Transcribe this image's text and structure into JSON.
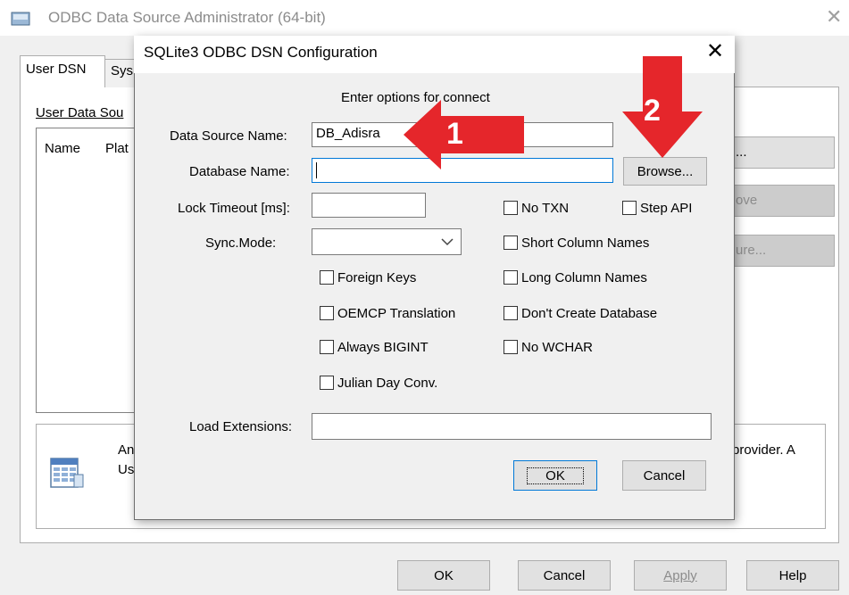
{
  "background_window": {
    "title": "ODBC Data Source Administrator (64-bit)",
    "close_glyph": "✕",
    "tabs": [
      {
        "label": "User DSN"
      },
      {
        "label": "Sys"
      }
    ],
    "user_data_sources_label": "User Data Sou",
    "list_columns": [
      "Name",
      "Plat"
    ],
    "side_buttons": {
      "add": "...",
      "remove": "ove",
      "configure": "ure..."
    },
    "info": {
      "line1": "An",
      "line2": "Us",
      "right_text": "provider.  A"
    },
    "buttons": {
      "ok": "OK",
      "cancel": "Cancel",
      "apply": "Apply",
      "help": "Help"
    }
  },
  "dialog": {
    "title": "SQLite3 ODBC DSN Configuration",
    "close_glyph": "✕",
    "enter_options": "Enter options for connect",
    "data_source_name": {
      "label": "Data Source Name:",
      "value": "DB_Adisra"
    },
    "database_name": {
      "label": "Database Name:",
      "value": ""
    },
    "browse_button": "Browse...",
    "lock_timeout": {
      "label": "Lock Timeout [ms]:",
      "value": ""
    },
    "sync_mode": {
      "label": "Sync.Mode:",
      "value": ""
    },
    "checkboxes": {
      "no_txn": {
        "label": "No TXN",
        "checked": false
      },
      "step_api": {
        "label": "Step API",
        "checked": false
      },
      "short_column_names": {
        "label": "Short Column Names",
        "checked": false
      },
      "foreign_keys": {
        "label": "Foreign Keys",
        "checked": false
      },
      "long_column_names": {
        "label": "Long Column Names",
        "checked": false
      },
      "oemcp_translation": {
        "label": "OEMCP Translation",
        "checked": false
      },
      "dont_create_database": {
        "label": "Don't Create Database",
        "checked": false
      },
      "always_bigint": {
        "label": "Always BIGINT",
        "checked": false
      },
      "no_wchar": {
        "label": "No WCHAR",
        "checked": false
      },
      "julian_day_conv": {
        "label": "Julian Day Conv.",
        "checked": false
      }
    },
    "load_extensions": {
      "label": "Load Extensions:",
      "value": ""
    },
    "ok_button": "OK",
    "cancel_button": "Cancel"
  },
  "annotations": {
    "arrow_1_label": "1",
    "arrow_2_label": "2",
    "color": "#e5262b"
  },
  "icons": [
    "odbc-window-icon",
    "close-icon",
    "data-source-icon",
    "chevron-down-icon",
    "red-arrow-left-icon",
    "red-arrow-down-icon"
  ]
}
